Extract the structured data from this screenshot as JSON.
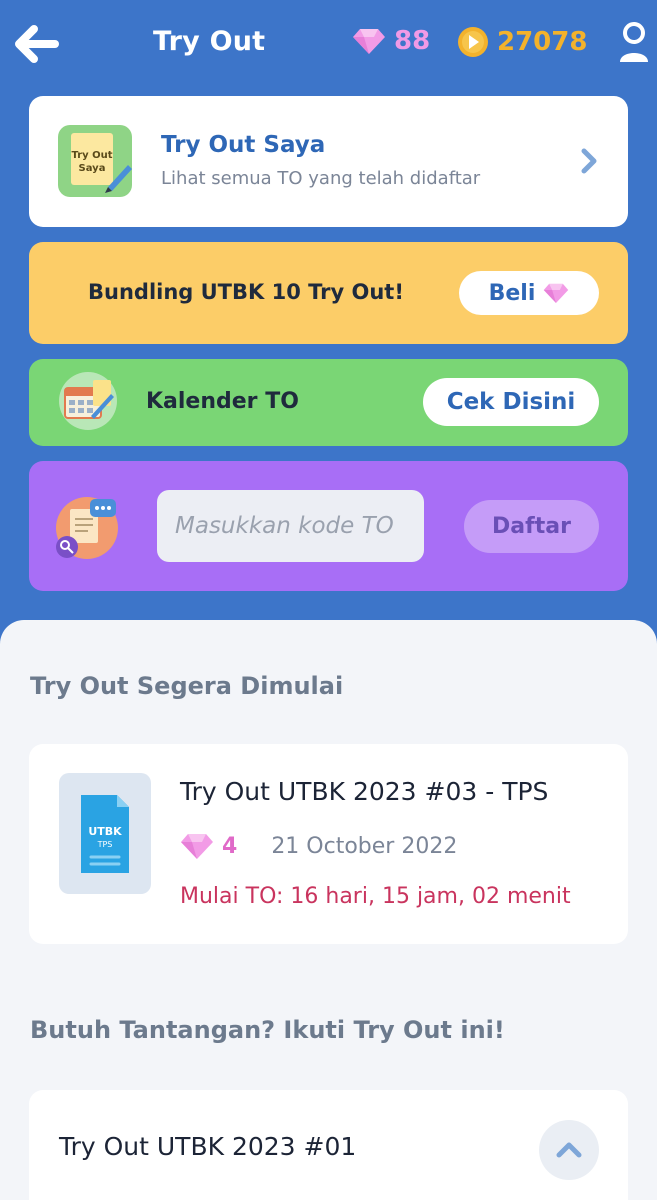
{
  "header": {
    "title": "Try Out",
    "gems": "88",
    "coins": "27078"
  },
  "my_tryout": {
    "icon_text_line1": "Try Out",
    "icon_text_line2": "Saya",
    "title": "Try Out Saya",
    "subtitle": "Lihat semua TO yang telah didaftar"
  },
  "bundle": {
    "text": "Bundling UTBK 10 Try Out!",
    "button_label": "Beli"
  },
  "calendar": {
    "text": "Kalender TO",
    "button_label": "Cek Disini"
  },
  "code": {
    "placeholder": "Masukkan kode TO",
    "button_label": "Daftar"
  },
  "upcoming": {
    "section_title": "Try Out Segera Dimulai",
    "item": {
      "thumb_line1": "UTBK",
      "thumb_line2": "TPS",
      "title": "Try Out UTBK 2023 #03 - TPS",
      "gem_cost": "4",
      "date": "21 October 2022",
      "countdown": "Mulai TO: 16 hari, 15 jam, 02 menit"
    }
  },
  "challenge": {
    "section_title": "Butuh Tantangan? Ikuti Try Out ini!",
    "item": {
      "title": "Try Out UTBK 2023 #01"
    }
  },
  "colors": {
    "header_bg": "#3d75c9",
    "gem": "#f09ae6",
    "coin": "#f3b22c",
    "bundle_bg": "#fccd68",
    "calendar_bg": "#7ad675",
    "code_bg": "#a86ef6",
    "countdown": "#c9345e"
  }
}
